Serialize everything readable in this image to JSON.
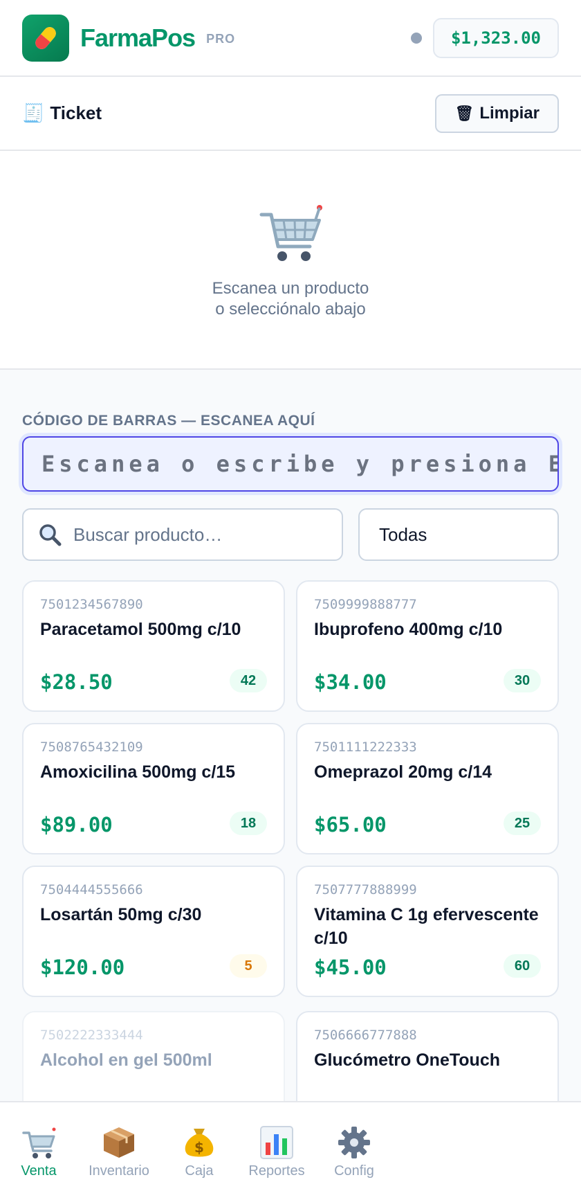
{
  "header": {
    "app_icon": "pill-icon",
    "app_name": "FarmaPos",
    "badge": "PRO",
    "total": "$1,323.00"
  },
  "ticket": {
    "title": "Ticket",
    "icon": "receipt-icon",
    "clear_label": "Limpiar",
    "empty_line1": "Escanea un producto",
    "empty_line2": "o selecciónalo abajo"
  },
  "scan": {
    "label": "CÓDIGO DE BARRAS — ESCANEA AQUÍ",
    "placeholder": "Escanea o escribe y presiona Enter"
  },
  "search": {
    "placeholder": "Buscar producto…",
    "category": "Todas"
  },
  "products": [
    {
      "code": "7501234567890",
      "name": "Paracetamol 500mg c/10",
      "price": "$28.50",
      "stock": "42"
    },
    {
      "code": "7509999888777",
      "name": "Ibuprofeno 400mg c/10",
      "price": "$34.00",
      "stock": "30"
    },
    {
      "code": "7508765432109",
      "name": "Amoxicilina 500mg c/15",
      "price": "$89.00",
      "stock": "18"
    },
    {
      "code": "7501111222333",
      "name": "Omeprazol 20mg c/14",
      "price": "$65.00",
      "stock": "25"
    },
    {
      "code": "7504444555666",
      "name": "Losartán 50mg c/30",
      "price": "$120.00",
      "stock": "5"
    },
    {
      "code": "7507777888999",
      "name": "Vitamina C 1g efervescente c/10",
      "price": "$45.00",
      "stock": "60"
    },
    {
      "code": "7502222333444",
      "name": "Alcohol en gel 500ml"
    },
    {
      "code": "7506666777888",
      "name": "Glucómetro OneTouch"
    }
  ],
  "nav": [
    {
      "label": "Venta",
      "icon": "cart-icon"
    },
    {
      "label": "Inventario",
      "icon": "box-icon"
    },
    {
      "label": "Caja",
      "icon": "money-bag-icon"
    },
    {
      "label": "Reportes",
      "icon": "bar-chart-icon"
    },
    {
      "label": "Config",
      "icon": "gear-icon"
    }
  ]
}
